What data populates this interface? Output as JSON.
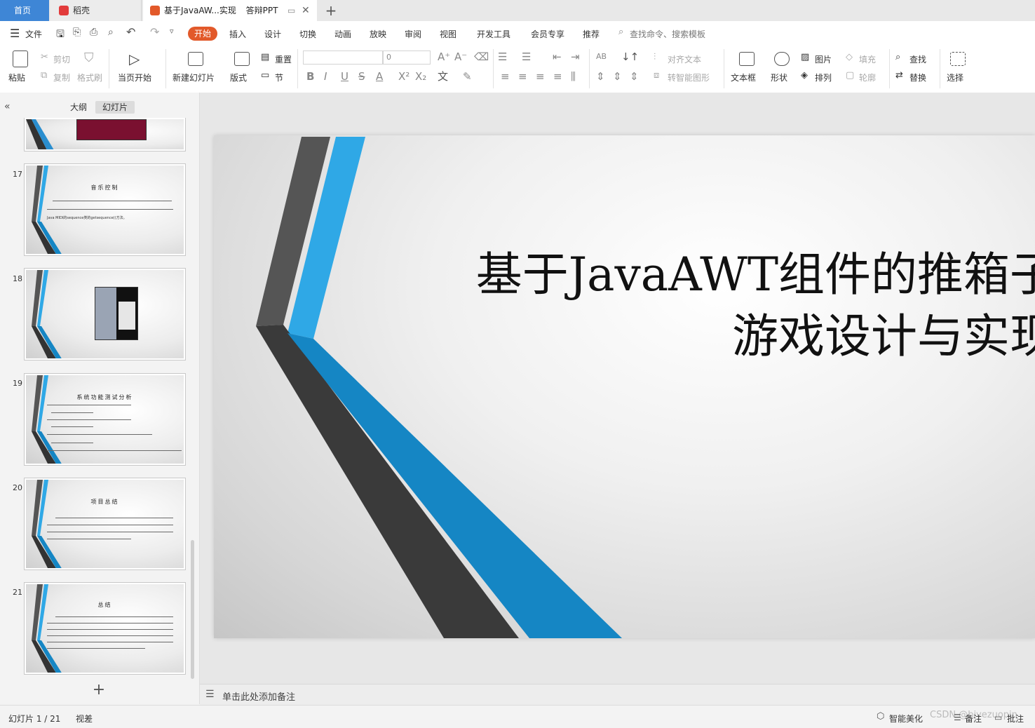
{
  "tabs": {
    "home": "首页",
    "daoke": "稻壳",
    "doc_title": "基于JavaAW...实现",
    "doc_sub": "答辩PPT"
  },
  "menu": {
    "file": "文件",
    "items": [
      "开始",
      "插入",
      "设计",
      "切换",
      "动画",
      "放映",
      "审阅",
      "视图",
      "开发工具",
      "会员专享",
      "推荐"
    ],
    "search_placeholder": "查找命令、搜索模板"
  },
  "ribbon": {
    "paste": "粘贴",
    "cut": "剪切",
    "copy": "复制",
    "format_painter": "格式刷",
    "from_current": "当页开始",
    "new_slide": "新建幻灯片",
    "layout": "版式",
    "reset": "重置",
    "section": "节",
    "font_size": "0",
    "align_text": "对齐文本",
    "smart_shape": "转智能图形",
    "textbox": "文本框",
    "shape": "形状",
    "picture": "图片",
    "arrange": "排列",
    "fill": "填充",
    "outline": "轮廓",
    "find": "查找",
    "replace": "替换",
    "select": "选择"
  },
  "panel": {
    "outline_tab": "大纲",
    "slides_tab": "幻灯片"
  },
  "thumbnails": [
    {
      "num": "17",
      "title": "音乐控制",
      "snippet": "Java MIDI的sequence类的getsequence()方法。"
    },
    {
      "num": "18",
      "title": "",
      "snippet": ""
    },
    {
      "num": "19",
      "title": "系统功能测试分析",
      "snippet": ""
    },
    {
      "num": "20",
      "title": "项目总结",
      "snippet": ""
    },
    {
      "num": "21",
      "title": "总结",
      "snippet": ""
    }
  ],
  "slide": {
    "title_line1": "基于JavaAWT组件的推箱子",
    "title_line2": "游戏设计与实现"
  },
  "notes": {
    "placeholder": "单击此处添加备注"
  },
  "status": {
    "slide_counter": "幻灯片 1 / 21",
    "view": "视差",
    "smart_beautify": "智能美化",
    "notes": "备注",
    "comments": "批注",
    "watermark": "CSDN @biyezuopin"
  },
  "colors": {
    "accent_orange": "#e2592a",
    "tab_blue": "#3e86d6",
    "slide_blue": "#2fa8e6",
    "slide_dark_blue": "#1586c4",
    "slide_dark_gray": "#3a3a3a",
    "slide_gray": "#555555"
  }
}
